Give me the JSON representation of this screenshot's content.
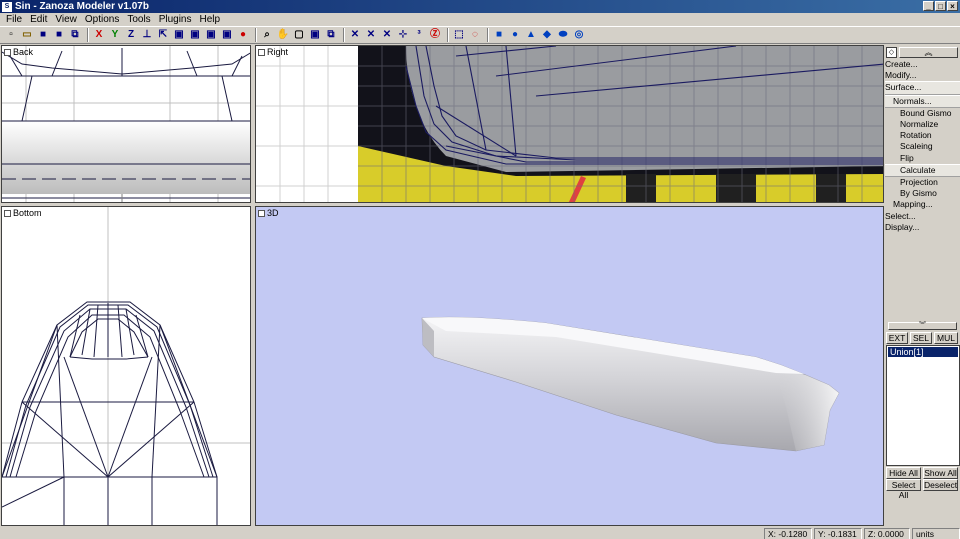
{
  "window": {
    "icon_label": "S",
    "title": "Sin - Zanoza Modeler v1.07b",
    "minimize": "_",
    "maximize": "□",
    "close": "×"
  },
  "menu": [
    "File",
    "Edit",
    "View",
    "Options",
    "Tools",
    "Plugins",
    "Help"
  ],
  "toolbar": {
    "groups": [
      [
        {
          "name": "new-icon",
          "glyph": "▫",
          "color": "#000000"
        },
        {
          "name": "open-icon",
          "glyph": "▭",
          "color": "#806000"
        },
        {
          "name": "save-icon",
          "glyph": "■",
          "color": "#000080"
        },
        {
          "name": "save-as-icon",
          "glyph": "■",
          "color": "#000080"
        },
        {
          "name": "import-icon",
          "glyph": "⧉",
          "color": "#000080"
        }
      ],
      [
        {
          "name": "axis-x-icon",
          "glyph": "X",
          "color": "#cc0000"
        },
        {
          "name": "axis-y-icon",
          "glyph": "Y",
          "color": "#008000"
        },
        {
          "name": "axis-z-icon",
          "glyph": "Z",
          "color": "#000080"
        },
        {
          "name": "axis-lock-icon",
          "glyph": "⊥",
          "color": "#000080"
        },
        {
          "name": "move-icon",
          "glyph": "⇱",
          "color": "#000080"
        },
        {
          "name": "cube-icon",
          "glyph": "▣",
          "color": "#000080"
        },
        {
          "name": "cube-faces-icon",
          "glyph": "▣",
          "color": "#000080"
        },
        {
          "name": "cube-edges-icon",
          "glyph": "▣",
          "color": "#000080"
        },
        {
          "name": "cube-vertices-icon",
          "glyph": "▣",
          "color": "#000080"
        },
        {
          "name": "sphere-render-icon",
          "glyph": "●",
          "color": "#cc0000"
        }
      ],
      [
        {
          "name": "zoom-icon",
          "glyph": "⌕",
          "color": "#000000"
        },
        {
          "name": "pan-icon",
          "glyph": "✋",
          "color": "#000000"
        },
        {
          "name": "view-cube-icon",
          "glyph": "▢",
          "color": "#000000"
        },
        {
          "name": "zoom-extents-icon",
          "glyph": "▣",
          "color": "#000080"
        },
        {
          "name": "zoom-all-icon",
          "glyph": "⧉",
          "color": "#000080"
        }
      ],
      [
        {
          "name": "select-vertex-icon",
          "glyph": "✕",
          "color": "#000080"
        },
        {
          "name": "select-edge-icon",
          "glyph": "✕",
          "color": "#000080"
        },
        {
          "name": "select-face-icon",
          "glyph": "✕",
          "color": "#000080"
        },
        {
          "name": "pivot-icon",
          "glyph": "⊹",
          "color": "#000080"
        },
        {
          "name": "view-3d-icon",
          "glyph": "³",
          "color": "#000080"
        },
        {
          "name": "zanoza-z-icon",
          "glyph": "Ⓩ",
          "color": "#cc0000"
        }
      ],
      [
        {
          "name": "rect-select-icon",
          "glyph": "⬚",
          "color": "#000080"
        },
        {
          "name": "circle-select-icon",
          "glyph": "◌",
          "color": "#cc0000"
        }
      ],
      [
        {
          "name": "box-primitive-icon",
          "glyph": "■",
          "color": "#0040c0"
        },
        {
          "name": "sphere-primitive-icon",
          "glyph": "●",
          "color": "#0040c0"
        },
        {
          "name": "cone-primitive-icon",
          "glyph": "▲",
          "color": "#0040c0"
        },
        {
          "name": "cylinder-primitive-icon",
          "glyph": "◆",
          "color": "#0040c0"
        },
        {
          "name": "disc-primitive-icon",
          "glyph": "⬬",
          "color": "#0040c0"
        },
        {
          "name": "torus-primitive-icon",
          "glyph": "◎",
          "color": "#0040c0"
        }
      ]
    ]
  },
  "viewports": {
    "back": "Back",
    "right": "Right",
    "bottom": "Bottom",
    "three_d": "3D"
  },
  "panel": {
    "pin": "◇",
    "collapse": "︽",
    "tree": [
      {
        "label": "Create...",
        "level": 1
      },
      {
        "label": "Modify...",
        "level": 1
      },
      {
        "label": "Surface...",
        "level": 1,
        "selected": true
      },
      {
        "label": "Normals...",
        "level": 2,
        "selected": true
      },
      {
        "label": "Bound Gismo",
        "level": 3
      },
      {
        "label": "Normalize",
        "level": 3
      },
      {
        "label": "Rotation",
        "level": 3
      },
      {
        "label": "Scaleing",
        "level": 3
      },
      {
        "label": "Flip",
        "level": 3
      },
      {
        "label": "Calculate",
        "level": 3,
        "selected": true
      },
      {
        "label": "Projection",
        "level": 3
      },
      {
        "label": "By Gismo",
        "level": 3
      },
      {
        "label": "Mapping...",
        "level": 2
      },
      {
        "label": "Select...",
        "level": 1
      },
      {
        "label": "Display...",
        "level": 1
      }
    ],
    "expand": "︾",
    "mode_buttons": [
      "EXT",
      "SEL",
      "MUL"
    ],
    "objects": [
      "Union[1]"
    ],
    "hide_all": "Hide All",
    "show_all": "Show All",
    "select_all": "Select All",
    "deselect": "Deselect"
  },
  "status": {
    "x": "X: -0.1280",
    "y": "Y: -0.1831",
    "z": "Z: 0.0000",
    "units": "units"
  }
}
